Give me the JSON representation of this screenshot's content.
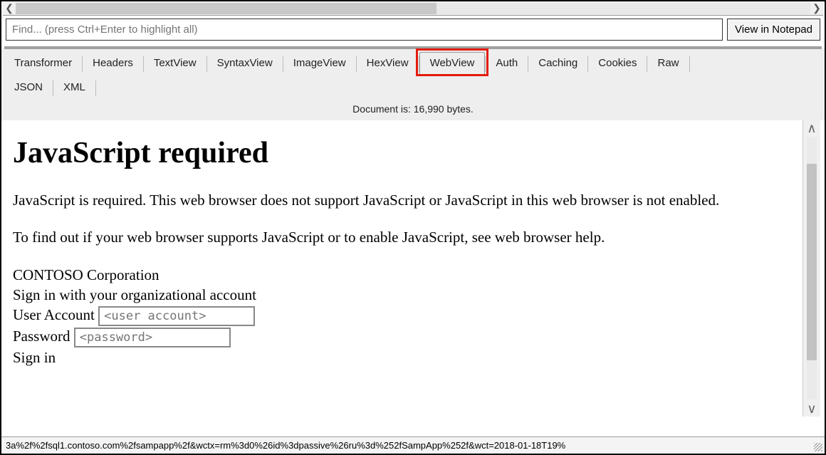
{
  "find": {
    "placeholder": "Find... (press Ctrl+Enter to highlight all)",
    "notepad_button": "View in Notepad"
  },
  "tabs": {
    "row1": [
      "Transformer",
      "Headers",
      "TextView",
      "SyntaxView",
      "ImageView",
      "HexView",
      "WebView",
      "Auth",
      "Caching",
      "Cookies",
      "Raw"
    ],
    "row2": [
      "JSON",
      "XML"
    ],
    "active": "WebView"
  },
  "doc_info": "Document is: 16,990 bytes.",
  "web": {
    "h1": "JavaScript required",
    "p1": "JavaScript is required. This web browser does not support JavaScript or JavaScript in this web browser is not enabled.",
    "p2": "To find out if your web browser supports JavaScript or to enable JavaScript, see web browser help.",
    "corp": "CONTOSO Corporation",
    "signin_prompt": "Sign in with your organizational account",
    "user_label": "User Account",
    "user_placeholder": "<user account>",
    "pass_label": "Password",
    "pass_placeholder": "<password>",
    "signin_btn": "Sign in"
  },
  "status": "3a%2f%2fsql1.contoso.com%2fsampapp%2f&wctx=rm%3d0%26id%3dpassive%26ru%3d%252fSampApp%252f&wct=2018-01-18T19%"
}
